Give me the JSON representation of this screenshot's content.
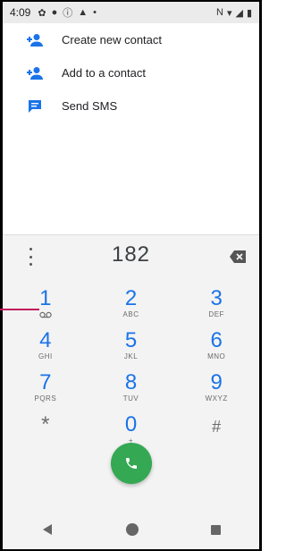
{
  "status_bar": {
    "time": "4:09"
  },
  "actions": [
    {
      "label": "Create new contact",
      "icon": "add-person-icon"
    },
    {
      "label": "Add to a contact",
      "icon": "add-person-icon"
    },
    {
      "label": "Send SMS",
      "icon": "message-icon"
    }
  ],
  "dialpad": {
    "digits": "182",
    "keys": [
      [
        {
          "digit": "1",
          "sub": ""
        },
        {
          "digit": "2",
          "sub": "ABC"
        },
        {
          "digit": "3",
          "sub": "DEF"
        }
      ],
      [
        {
          "digit": "4",
          "sub": "GHI"
        },
        {
          "digit": "5",
          "sub": "JKL"
        },
        {
          "digit": "6",
          "sub": "MNO"
        }
      ],
      [
        {
          "digit": "7",
          "sub": "PQRS"
        },
        {
          "digit": "8",
          "sub": "TUV"
        },
        {
          "digit": "9",
          "sub": "WXYZ"
        }
      ],
      [
        {
          "digit": "*",
          "sub": ""
        },
        {
          "digit": "0",
          "sub": "+"
        },
        {
          "digit": "#",
          "sub": ""
        }
      ]
    ]
  },
  "colors": {
    "accent": "#1a73e8",
    "call_button": "#34a853",
    "pointer": "#c2185b"
  }
}
